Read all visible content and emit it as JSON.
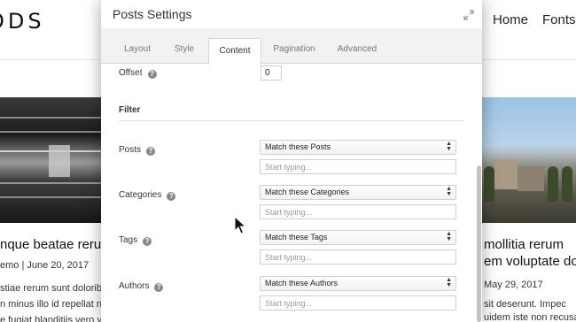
{
  "site": {
    "logo": "ODS",
    "nav": {
      "home": "Home",
      "fonts": "Fonts"
    },
    "left_card": {
      "title": "nque beatae rerum",
      "meta": "emo | June 20, 2017",
      "excerpt1": "stiae rerum sunt doloribus fu",
      "excerpt2": "n minus illo id repellat numqu",
      "excerpt3": "e fugiat blanditiis vero volupt"
    },
    "right_card": {
      "title1": "mollitia rerum",
      "title2": "em voluptate dolo",
      "meta": "May 29, 2017",
      "excerpt1": "sit deserunt. Impec",
      "excerpt2": "uidem iste non recusa"
    }
  },
  "modal": {
    "title": "Posts Settings",
    "tabs": [
      {
        "label": "Layout",
        "active": false
      },
      {
        "label": "Style",
        "active": false
      },
      {
        "label": "Content",
        "active": true
      },
      {
        "label": "Pagination",
        "active": false
      },
      {
        "label": "Advanced",
        "active": false
      }
    ],
    "offset": {
      "label": "Offset",
      "value": "0"
    },
    "filter": {
      "section_title": "Filter",
      "fields": [
        {
          "label": "Posts",
          "select": "Match these Posts",
          "placeholder": "Start typing..."
        },
        {
          "label": "Categories",
          "select": "Match these Categories",
          "placeholder": "Start typing..."
        },
        {
          "label": "Tags",
          "select": "Match these Tags",
          "placeholder": "Start typing..."
        },
        {
          "label": "Authors",
          "select": "Match these Authors",
          "placeholder": "Start typing..."
        }
      ]
    }
  },
  "icons": {
    "help": "question-circle-icon",
    "expand": "expand-arrows-icon",
    "select_arrows": "updown-arrows-icon",
    "cursor": "mouse-pointer-icon"
  },
  "colors": {
    "modal_bg": "#ffffff",
    "tab_bar_bg": "#f2f2f2",
    "border": "#cfcfcf",
    "help_icon": "#888888",
    "scroll_thumb": "#c4c4c4"
  }
}
